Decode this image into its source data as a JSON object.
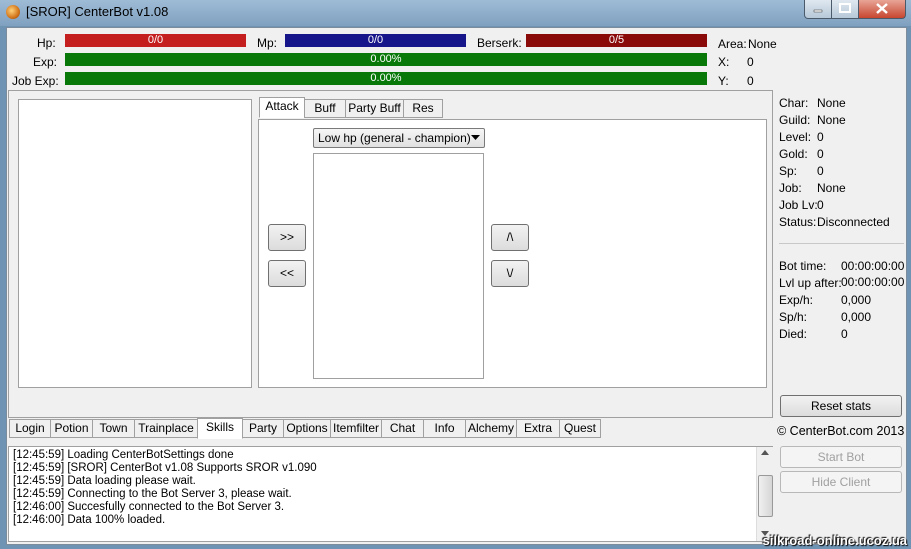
{
  "window": {
    "title": "[SROR] CenterBot v1.08"
  },
  "status_bars": {
    "hp": {
      "label": "Hp:",
      "value": "0/0",
      "color": "#c41e1e"
    },
    "mp": {
      "label": "Mp:",
      "value": "0/0",
      "color": "#16168a"
    },
    "berserk": {
      "label": "Berserk:",
      "value": "0/5",
      "color": "#8a0a0a"
    },
    "exp": {
      "label": "Exp:",
      "value": "0.00%",
      "color": "#087808"
    },
    "job_exp": {
      "label": "Job Exp:",
      "value": "0.00%",
      "color": "#087808"
    }
  },
  "location": {
    "area_label": "Area:",
    "area_value": "None",
    "x_label": "X:",
    "x_value": "0",
    "y_label": "Y:",
    "y_value": "0"
  },
  "skill_tabs": [
    "Attack",
    "Buff",
    "Party Buff",
    "Res"
  ],
  "attack": {
    "dropdown_value": "Low hp (general - champion)",
    "add_label": ">>",
    "remove_label": "<<",
    "up_label": "/\\",
    "down_label": "\\/"
  },
  "char_info": [
    {
      "label": "Char:",
      "value": "None"
    },
    {
      "label": "Guild:",
      "value": "None"
    },
    {
      "label": "Level:",
      "value": "0"
    },
    {
      "label": "Gold:",
      "value": "0"
    },
    {
      "label": "Sp:",
      "value": "0"
    },
    {
      "label": "Job:",
      "value": "None"
    },
    {
      "label": "Job Lv:",
      "value": "0"
    },
    {
      "label": "Status:",
      "value": "Disconnected"
    }
  ],
  "stats": [
    {
      "label": "Bot time:",
      "value": "00:00:00:00"
    },
    {
      "label": "Lvl up after:",
      "value": "00:00:00:00"
    },
    {
      "label": "Exp/h:",
      "value": "0,000"
    },
    {
      "label": "Sp/h:",
      "value": "0,000"
    },
    {
      "label": "Died:",
      "value": "0"
    }
  ],
  "buttons": {
    "reset_stats": "Reset stats",
    "start_bot": "Start Bot",
    "hide_client": "Hide Client"
  },
  "copyright": "© CenterBot.com 2013",
  "main_tabs": [
    "Login",
    "Potion",
    "Town",
    "Trainplace",
    "Skills",
    "Party",
    "Options",
    "Itemfilter",
    "Chat",
    "Info",
    "Alchemy",
    "Extra",
    "Quest"
  ],
  "log": [
    "[12:45:59] Loading CenterBotSettings done",
    "[12:45:59] [SROR] CenterBot v1.08 Supports SROR v1.090",
    "[12:45:59] Data loading please wait.",
    "[12:45:59] Connecting to the Bot Server 3, please wait.",
    "[12:46:00] Succesfully connected to the Bot Server 3.",
    "[12:46:00] Data 100% loaded."
  ],
  "watermark": "silkroad-online.ucoz.ua"
}
